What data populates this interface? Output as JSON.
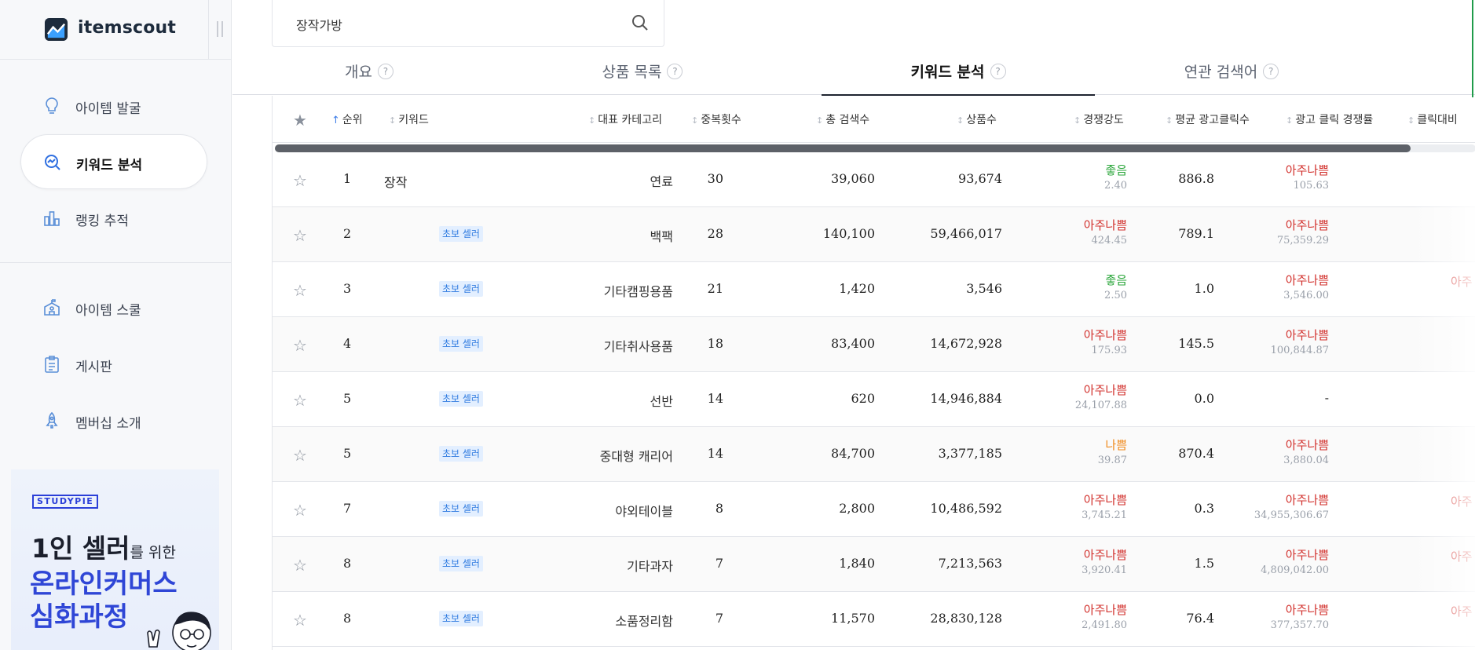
{
  "app": {
    "name": "itemscout"
  },
  "colors": {
    "good": "#2aa63a",
    "bad": "#d2302c",
    "warn": "#f08a1c",
    "accent": "#2f46d6"
  },
  "sidebar": {
    "items": [
      {
        "label": "아이템 발굴",
        "icon": "lightbulb-icon"
      },
      {
        "label": "키워드 분석",
        "icon": "keyword-analysis-icon",
        "active": true
      },
      {
        "label": "랭킹 추적",
        "icon": "bar-chart-icon"
      },
      {
        "label": "아이템 스쿨",
        "icon": "school-icon"
      },
      {
        "label": "게시판",
        "icon": "clipboard-icon"
      },
      {
        "label": "멤버십 소개",
        "icon": "rocket-icon"
      }
    ],
    "promo": {
      "badge": "STUDYPIE",
      "line1_big": "1인 셀러",
      "line1_small": "를 위한",
      "line2": "온라인커머스",
      "line3": "심화과정"
    }
  },
  "search": {
    "value": "장작가방"
  },
  "tabs": [
    {
      "label": "개요",
      "help": "?"
    },
    {
      "label": "상품 목록",
      "help": "?"
    },
    {
      "label": "키워드 분석",
      "help": "?",
      "active": true
    },
    {
      "label": "연관 검색어",
      "help": "?"
    }
  ],
  "table": {
    "headers": {
      "rank": "순위",
      "keyword": "키워드",
      "category": "대표 카테고리",
      "dup": "중복횟수",
      "search": "총 검색수",
      "products": "상품수",
      "competition": "경쟁강도",
      "avg_clicks": "평균 광고클릭수",
      "ad_comp": "광고 클릭 경쟁률",
      "click_ratio": "클릭대비"
    },
    "badge_label": "초보 셀러",
    "rows": [
      {
        "rank": "1",
        "keyword": "장작",
        "badge": false,
        "category": "연료",
        "dup": "30",
        "search": "39,060",
        "products": "93,674",
        "comp_level": "좋음",
        "comp_tone": "good",
        "comp_value": "2.40",
        "avg_clicks": "886.8",
        "ad_level": "아주나쁨",
        "ad_value": "105.63",
        "cut": ""
      },
      {
        "rank": "2",
        "keyword": "",
        "badge": true,
        "category": "백팩",
        "dup": "28",
        "search": "140,100",
        "products": "59,466,017",
        "comp_level": "아주나쁨",
        "comp_tone": "bad",
        "comp_value": "424.45",
        "avg_clicks": "789.1",
        "ad_level": "아주나쁨",
        "ad_value": "75,359.29",
        "cut": ""
      },
      {
        "rank": "3",
        "keyword": "",
        "badge": true,
        "category": "기타캠핑용품",
        "dup": "21",
        "search": "1,420",
        "products": "3,546",
        "comp_level": "좋음",
        "comp_tone": "good",
        "comp_value": "2.50",
        "avg_clicks": "1.0",
        "ad_level": "아주나쁨",
        "ad_value": "3,546.00",
        "cut": "아주"
      },
      {
        "rank": "4",
        "keyword": "",
        "badge": true,
        "category": "기타취사용품",
        "dup": "18",
        "search": "83,400",
        "products": "14,672,928",
        "comp_level": "아주나쁨",
        "comp_tone": "bad",
        "comp_value": "175.93",
        "avg_clicks": "145.5",
        "ad_level": "아주나쁨",
        "ad_value": "100,844.87",
        "cut": ""
      },
      {
        "rank": "5",
        "keyword": "",
        "badge": true,
        "category": "선반",
        "dup": "14",
        "search": "620",
        "products": "14,946,884",
        "comp_level": "아주나쁨",
        "comp_tone": "bad",
        "comp_value": "24,107.88",
        "avg_clicks": "0.0",
        "ad_level": "",
        "ad_value": "-",
        "cut": ""
      },
      {
        "rank": "5",
        "keyword": "",
        "badge": true,
        "category": "중대형 캐리어",
        "dup": "14",
        "search": "84,700",
        "products": "3,377,185",
        "comp_level": "나쁨",
        "comp_tone": "warn",
        "comp_value": "39.87",
        "avg_clicks": "870.4",
        "ad_level": "아주나쁨",
        "ad_value": "3,880.04",
        "cut": ""
      },
      {
        "rank": "7",
        "keyword": "",
        "badge": true,
        "category": "야외테이블",
        "dup": "8",
        "search": "2,800",
        "products": "10,486,592",
        "comp_level": "아주나쁨",
        "comp_tone": "bad",
        "comp_value": "3,745.21",
        "avg_clicks": "0.3",
        "ad_level": "아주나쁨",
        "ad_value": "34,955,306.67",
        "cut": "아주"
      },
      {
        "rank": "8",
        "keyword": "",
        "badge": true,
        "category": "기타과자",
        "dup": "7",
        "search": "1,840",
        "products": "7,213,563",
        "comp_level": "아주나쁨",
        "comp_tone": "bad",
        "comp_value": "3,920.41",
        "avg_clicks": "1.5",
        "ad_level": "아주나쁨",
        "ad_value": "4,809,042.00",
        "cut": "아주"
      },
      {
        "rank": "8",
        "keyword": "",
        "badge": true,
        "category": "소품정리함",
        "dup": "7",
        "search": "11,570",
        "products": "28,830,128",
        "comp_level": "아주나쁨",
        "comp_tone": "bad",
        "comp_value": "2,491.80",
        "avg_clicks": "76.4",
        "ad_level": "아주나쁨",
        "ad_value": "377,357.70",
        "cut": "아주"
      }
    ]
  }
}
